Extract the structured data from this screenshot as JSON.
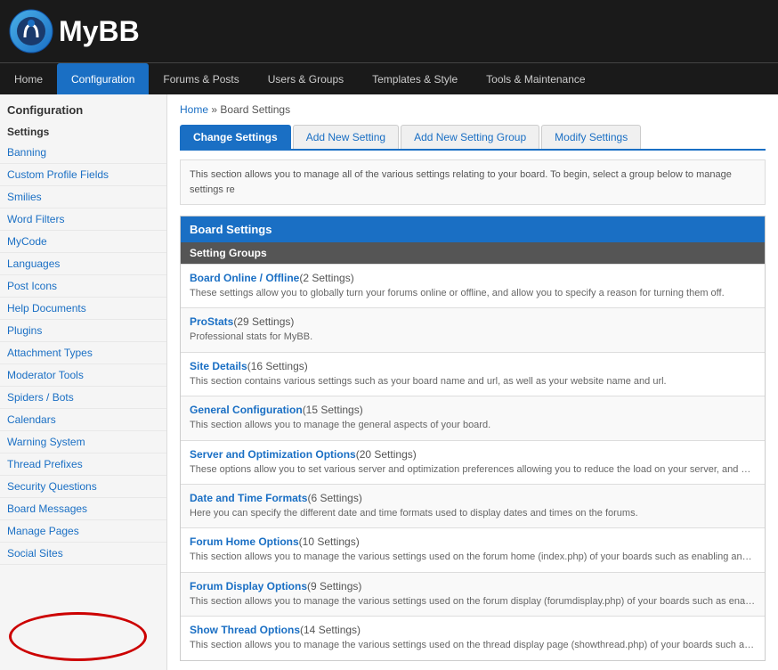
{
  "header": {
    "logo_text": "MyBB"
  },
  "nav": {
    "items": [
      {
        "label": "Home",
        "active": false
      },
      {
        "label": "Configuration",
        "active": true
      },
      {
        "label": "Forums & Posts",
        "active": false
      },
      {
        "label": "Users & Groups",
        "active": false
      },
      {
        "label": "Templates & Style",
        "active": false
      },
      {
        "label": "Tools & Maintenance",
        "active": false
      }
    ]
  },
  "sidebar": {
    "title": "Configuration",
    "subtitle": "Settings",
    "items": [
      "Banning",
      "Custom Profile Fields",
      "Smilies",
      "Word Filters",
      "MyCode",
      "Languages",
      "Post Icons",
      "Help Documents",
      "Plugins",
      "Attachment Types",
      "Moderator Tools",
      "Spiders / Bots",
      "Calendars",
      "Warning System",
      "Thread Prefixes",
      "Security Questions",
      "Board Messages",
      "Manage Pages",
      "Social Sites"
    ]
  },
  "breadcrumb": {
    "home": "Home",
    "separator": "»",
    "current": "Board Settings"
  },
  "tabs": [
    {
      "label": "Change Settings",
      "active": true
    },
    {
      "label": "Add New Setting",
      "active": false
    },
    {
      "label": "Add New Setting Group",
      "active": false
    },
    {
      "label": "Modify Settings",
      "active": false
    }
  ],
  "info_text": "This section allows you to manage all of the various settings relating to your board. To begin, select a group below to manage settings re",
  "panel": {
    "title": "Board Settings",
    "subheader": "Setting Groups",
    "groups": [
      {
        "title": "Board Online / Offline",
        "count": "(2 Settings)",
        "desc": "These settings allow you to globally turn your forums online or offline, and allow you to specify a reason for turning them off."
      },
      {
        "title": "ProStats",
        "count": "(29 Settings)",
        "desc": "Professional stats for MyBB."
      },
      {
        "title": "Site Details",
        "count": "(16 Settings)",
        "desc": "This section contains various settings such as your board name and url, as well as your website name and url."
      },
      {
        "title": "General Configuration",
        "count": "(15 Settings)",
        "desc": "This section allows you to manage the general aspects of your board."
      },
      {
        "title": "Server and Optimization Options",
        "count": "(20 Settings)",
        "desc": "These options allow you to set various server and optimization preferences allowing you to reduce the load on your server, and gain bett"
      },
      {
        "title": "Date and Time Formats",
        "count": "(6 Settings)",
        "desc": "Here you can specify the different date and time formats used to display dates and times on the forums."
      },
      {
        "title": "Forum Home Options",
        "count": "(10 Settings)",
        "desc": "This section allows you to manage the various settings used on the forum home (index.php) of your boards such as enabling and disabling"
      },
      {
        "title": "Forum Display Options",
        "count": "(9 Settings)",
        "desc": "This section allows you to manage the various settings used on the forum display (forumdisplay.php) of your boards such as enabling and"
      },
      {
        "title": "Show Thread Options",
        "count": "(14 Settings)",
        "desc": "This section allows you to manage the various settings used on the thread display page (showthread.php) of your boards such as enablin"
      }
    ]
  }
}
